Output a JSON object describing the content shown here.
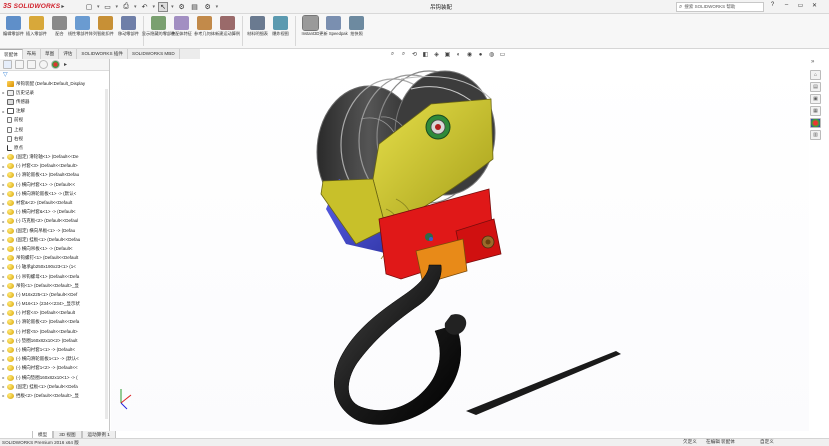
{
  "app": {
    "logo_ds": "3S",
    "logo_name": "SOLIDWORKS",
    "title": "吊钩装配",
    "search_placeholder": "搜索 SOLIDWORKS 帮助",
    "status": "SOLIDWORKS Premium 2016 x64 版",
    "status_right": [
      "欠定义",
      "在编辑 装配体",
      "自定义"
    ]
  },
  "ribbon": {
    "buttons": [
      {
        "label": "编辑零部件",
        "color": "#5f8fc9"
      },
      {
        "label": "插入零部件",
        "color": "#d8a83a"
      },
      {
        "label": "配合",
        "color": "#8a8a8a"
      },
      {
        "label": "线性零部件阵列",
        "color": "#6a9bd1"
      },
      {
        "label": "智能扣件",
        "color": "#c79036"
      },
      {
        "label": "移动零部件",
        "color": "#6f7fa8"
      },
      {
        "label": "显示隐藏的零部件",
        "color": "#7aa070"
      },
      {
        "label": "装配体特征",
        "color": "#a28fc2"
      },
      {
        "label": "参考几何体",
        "color": "#c28a4a"
      },
      {
        "label": "新建运动算例",
        "color": "#9a6a6a"
      },
      {
        "label": "材料明细表",
        "color": "#6a7a90"
      },
      {
        "label": "爆炸视图",
        "color": "#5b9ab0"
      },
      {
        "label": "Instant3D",
        "color": "#888888",
        "active": true
      },
      {
        "label": "更新 Speedpak",
        "color": "#7a8fb0"
      },
      {
        "label": "拍快照",
        "color": "#6d8aa0"
      }
    ]
  },
  "command_tabs": [
    "装配体",
    "布局",
    "草图",
    "评估",
    "SOLIDWORKS 插件",
    "SOLIDWORKS MBD"
  ],
  "tree": {
    "root": "吊钩装配 (Default<Default_Display",
    "items": [
      {
        "text": "历史记录",
        "icon": "hist",
        "exp": "▸"
      },
      {
        "text": "传感器",
        "icon": "sensor",
        "exp": ""
      },
      {
        "text": "注解",
        "icon": "note",
        "exp": "▸"
      },
      {
        "text": "前视",
        "icon": "plane",
        "exp": ""
      },
      {
        "text": "上视",
        "icon": "plane",
        "exp": ""
      },
      {
        "text": "右视",
        "icon": "plane",
        "exp": ""
      },
      {
        "text": "原点",
        "icon": "origin",
        "exp": ""
      },
      {
        "text": "(固定) 滑轮轴<1> (Default<<De",
        "icon": "part",
        "exp": "▸"
      },
      {
        "text": "(-) 衬套<3> (Default<<Default>",
        "icon": "part",
        "exp": "▸"
      },
      {
        "text": "(-) 滑轮嵌板<1> (Default<Defau",
        "icon": "part",
        "exp": "▸"
      },
      {
        "text": "(-) 横向衬套<1> -> (Default<<",
        "icon": "part",
        "exp": "▸"
      },
      {
        "text": "(-) 横向滑轮嵌板<1> -> (默认<",
        "icon": "part",
        "exp": "▸"
      },
      {
        "text": "衬套&<2> (Default<<Default",
        "icon": "part",
        "exp": "▸"
      },
      {
        "text": "(-) 横向衬套&<1> -> (Default<",
        "icon": "part",
        "exp": "▸"
      },
      {
        "text": "(-) 巧克板<2> (Default<<Defaul",
        "icon": "part",
        "exp": "▸"
      },
      {
        "text": "(固定) 横向吊板<1> -> (Defau",
        "icon": "part",
        "exp": "▸"
      },
      {
        "text": "(固定) 挂板<1> (Default<<Defau",
        "icon": "part",
        "exp": "▸"
      },
      {
        "text": "(-) 横向吊板<1> -> (Default<",
        "icon": "part",
        "exp": "▸"
      },
      {
        "text": "吊钩螺钉<1> (Default<<Default",
        "icon": "part",
        "exp": "▸"
      },
      {
        "text": "(-) 轴承gb250x190x23<1> (1<",
        "icon": "part",
        "exp": "▸"
      },
      {
        "text": "(-) 吊钩螺母<1> (Default<<Defa",
        "icon": "part",
        "exp": "▸"
      },
      {
        "text": "吊钩<1> (Default<<Default>_显",
        "icon": "part",
        "exp": "▸"
      },
      {
        "text": "(-) M16x225<1> (Default<<Def",
        "icon": "part",
        "exp": "▸"
      },
      {
        "text": "(-) M16<1> (234<<234>_显示状",
        "icon": "part",
        "exp": "▸"
      },
      {
        "text": "(-) 衬套<4> (Default<<Default",
        "icon": "part",
        "exp": "▸"
      },
      {
        "text": "(-) 滑轮嵌板<2> (Default<<Defa",
        "icon": "part",
        "exp": "▸"
      },
      {
        "text": "(-) 衬套<5> (Default<<Default>",
        "icon": "part",
        "exp": "▸"
      },
      {
        "text": "(-) 垫圈160x82x10<2> (Default",
        "icon": "part",
        "exp": "▸"
      },
      {
        "text": "(-) 横向衬套1<1> -> (Default<",
        "icon": "part",
        "exp": "▸"
      },
      {
        "text": "(-) 横向滑轮嵌板1<1> -> (默认<",
        "icon": "part",
        "exp": "▸"
      },
      {
        "text": "(-) 横向衬套1<2> -> (Default<<",
        "icon": "part",
        "exp": "▸"
      },
      {
        "text": "(-) 横向垫圈160x82x10<1> -> (",
        "icon": "part",
        "exp": "▸"
      },
      {
        "text": "(固定) 挂板<1> (Default<<Defa",
        "icon": "part",
        "exp": "▸"
      },
      {
        "text": "挡板<2> (Default<<Default>_显",
        "icon": "part",
        "exp": "▸"
      }
    ]
  },
  "bottom_tabs": [
    "模型",
    "3D 视图",
    "运动算例 1"
  ],
  "colors": {
    "drum": "#3a3a3a",
    "shroud": "#c8c02a",
    "plate_blue": "#4a4fd0",
    "block_red": "#e01818",
    "block_orange": "#e88a18",
    "hook": "#1e1e1e",
    "logo": "#d11f2a"
  }
}
